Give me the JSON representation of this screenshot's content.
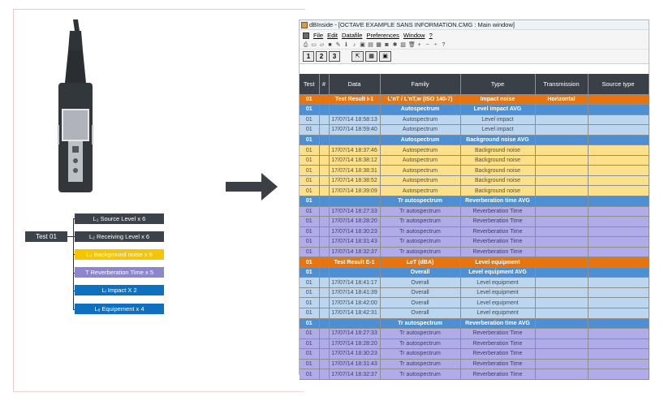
{
  "left": {
    "test_label": "Test 01",
    "measurements": [
      {
        "label": "L₁ Source Level x 6",
        "color": "#3b4249"
      },
      {
        "label": "L₂ Receiving Level x 6",
        "color": "#3b4249"
      },
      {
        "label": "L₃ Background noise x 5",
        "color": "#f7c400"
      },
      {
        "label": "T Reverberation Time x 5",
        "color": "#8c86cf"
      },
      {
        "label": "Lᵢ Impact X 2",
        "color": "#0f70c0"
      },
      {
        "label": "Lₑ Equipement x 4",
        "color": "#0f70c0"
      }
    ]
  },
  "window": {
    "title": "dBInside - [OCTAVE EXAMPLE SANS INFORMATION.CMG : Main window]",
    "menu": [
      "File",
      "Edit",
      "Datafile",
      "Preferences",
      "Window",
      "?"
    ],
    "view_buttons": [
      "1",
      "2",
      "3"
    ],
    "columns": [
      "Test",
      "#",
      "Data",
      "Family",
      "Type",
      "Transmission",
      "Source type"
    ],
    "rows": [
      {
        "style": "orange",
        "test": "01",
        "num": "",
        "data": "Test Result I-1",
        "family": "L'nT / L'nT,w (ISO 140-7)",
        "type": "Impact noise",
        "transmission": "Horizontal",
        "source": ""
      },
      {
        "style": "blue",
        "test": "01",
        "num": "",
        "data": "",
        "family": "Autospectrum",
        "type": "Level impact AVG",
        "transmission": "",
        "source": ""
      },
      {
        "style": "lblue",
        "test": "01",
        "num": "",
        "data": "17/07/14 18:58:13",
        "family": "Autospectrum",
        "type": "Level impact",
        "transmission": "",
        "source": ""
      },
      {
        "style": "lblue",
        "test": "01",
        "num": "",
        "data": "17/07/14 18:59:40",
        "family": "Autospectrum",
        "type": "Level impact",
        "transmission": "",
        "source": ""
      },
      {
        "style": "blue",
        "test": "01",
        "num": "",
        "data": "",
        "family": "Autospectrum",
        "type": "Background noise AVG",
        "transmission": "",
        "source": ""
      },
      {
        "style": "yellow",
        "test": "01",
        "num": "",
        "data": "17/07/14 18:37:46",
        "family": "Autospectrum",
        "type": "Background noise",
        "transmission": "",
        "source": ""
      },
      {
        "style": "yellow",
        "test": "01",
        "num": "",
        "data": "17/07/14 18:38:12",
        "family": "Autospectrum",
        "type": "Background noise",
        "transmission": "",
        "source": ""
      },
      {
        "style": "yellow",
        "test": "01",
        "num": "",
        "data": "17/07/14 18:38:31",
        "family": "Autospectrum",
        "type": "Background noise",
        "transmission": "",
        "source": ""
      },
      {
        "style": "yellow",
        "test": "01",
        "num": "",
        "data": "17/07/14 18:38:52",
        "family": "Autospectrum",
        "type": "Background noise",
        "transmission": "",
        "source": ""
      },
      {
        "style": "yellow",
        "test": "01",
        "num": "",
        "data": "17/07/14 18:39:09",
        "family": "Autospectrum",
        "type": "Background noise",
        "transmission": "",
        "source": ""
      },
      {
        "style": "blue",
        "test": "01",
        "num": "",
        "data": "",
        "family": "Tr autospectrum",
        "type": "Reverberation time AVG",
        "transmission": "",
        "source": ""
      },
      {
        "style": "purple",
        "test": "01",
        "num": "",
        "data": "17/07/14 18:27:33",
        "family": "Tr autospectrum",
        "type": "Reverberation Time",
        "transmission": "",
        "source": ""
      },
      {
        "style": "purple",
        "test": "01",
        "num": "",
        "data": "17/07/14 18:28:20",
        "family": "Tr autospectrum",
        "type": "Reverberation Time",
        "transmission": "",
        "source": ""
      },
      {
        "style": "purple",
        "test": "01",
        "num": "",
        "data": "17/07/14 18:30:23",
        "family": "Tr autospectrum",
        "type": "Reverberation Time",
        "transmission": "",
        "source": ""
      },
      {
        "style": "purple",
        "test": "01",
        "num": "",
        "data": "17/07/14 18:31:43",
        "family": "Tr autospectrum",
        "type": "Reverberation Time",
        "transmission": "",
        "source": ""
      },
      {
        "style": "purple",
        "test": "01",
        "num": "",
        "data": "17/07/14 18:32:37",
        "family": "Tr autospectrum",
        "type": "Reverberation Time",
        "transmission": "",
        "source": ""
      },
      {
        "style": "orange",
        "test": "01",
        "num": "",
        "data": "Test Result E-1",
        "family": "LeT (dBA)",
        "type": "Level equipment",
        "transmission": "",
        "source": ""
      },
      {
        "style": "blue",
        "test": "01",
        "num": "",
        "data": "",
        "family": "Overall",
        "type": "Level equipment AVG",
        "transmission": "",
        "source": ""
      },
      {
        "style": "lblue",
        "test": "01",
        "num": "",
        "data": "17/07/14 18:41:17",
        "family": "Overall",
        "type": "Level equipment",
        "transmission": "",
        "source": ""
      },
      {
        "style": "lblue",
        "test": "01",
        "num": "",
        "data": "17/07/14 18:41:39",
        "family": "Overall",
        "type": "Level equipment",
        "transmission": "",
        "source": ""
      },
      {
        "style": "lblue",
        "test": "01",
        "num": "",
        "data": "17/07/14 18:42:00",
        "family": "Overall",
        "type": "Level equipment",
        "transmission": "",
        "source": ""
      },
      {
        "style": "lblue",
        "test": "01",
        "num": "",
        "data": "17/07/14 18:42:31",
        "family": "Overall",
        "type": "Level equipment",
        "transmission": "",
        "source": ""
      },
      {
        "style": "blue",
        "test": "01",
        "num": "",
        "data": "",
        "family": "Tr autospectrum",
        "type": "Reverberation time AVG",
        "transmission": "",
        "source": ""
      },
      {
        "style": "purple",
        "test": "01",
        "num": "",
        "data": "17/07/14 18:27:33",
        "family": "Tr autospectrum",
        "type": "Reverberation Time",
        "transmission": "",
        "source": ""
      },
      {
        "style": "purple",
        "test": "01",
        "num": "",
        "data": "17/07/14 18:28:20",
        "family": "Tr autospectrum",
        "type": "Reverberation Time",
        "transmission": "",
        "source": ""
      },
      {
        "style": "purple",
        "test": "01",
        "num": "",
        "data": "17/07/14 18:30:23",
        "family": "Tr autospectrum",
        "type": "Reverberation Time",
        "transmission": "",
        "source": ""
      },
      {
        "style": "purple",
        "test": "01",
        "num": "",
        "data": "17/07/14 18:31:43",
        "family": "Tr autospectrum",
        "type": "Reverberation Time",
        "transmission": "",
        "source": ""
      },
      {
        "style": "purple",
        "test": "01",
        "num": "",
        "data": "17/07/14 18:32:37",
        "family": "Tr autospectrum",
        "type": "Reverberation Time",
        "transmission": "",
        "source": ""
      }
    ]
  }
}
